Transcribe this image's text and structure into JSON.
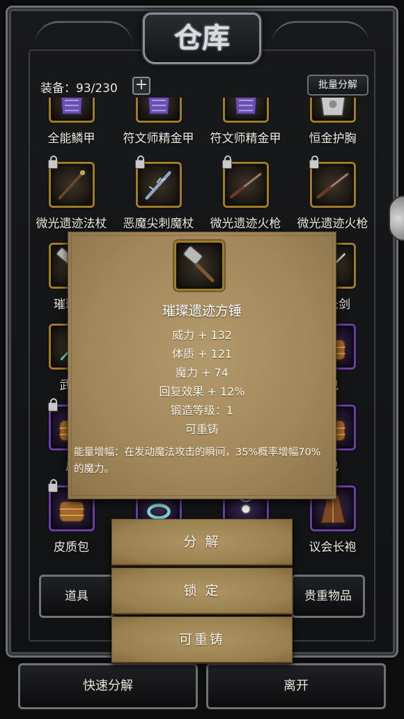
{
  "header": {
    "title": "仓库",
    "equip_label": "装备：93/230",
    "plus_label": "+",
    "bulk_decompose": "批量分解"
  },
  "grid": {
    "items": [
      {
        "name": "全能鳞甲",
        "icon": "purple-armor-icon",
        "locked": false,
        "rarity": "gold"
      },
      {
        "name": "符文师精金甲",
        "icon": "purple-armor-icon",
        "locked": false,
        "rarity": "gold"
      },
      {
        "name": "符文师精金甲",
        "icon": "purple-armor-icon",
        "locked": false,
        "rarity": "gold"
      },
      {
        "name": "恒金护胸",
        "icon": "silver-armor-icon",
        "locked": false,
        "rarity": "gold"
      },
      {
        "name": "微光遗迹法杖",
        "icon": "staff-icon",
        "locked": true,
        "rarity": "gold"
      },
      {
        "name": "恶魔尖刺魔杖",
        "icon": "spiked-wand-icon",
        "locked": true,
        "rarity": "gold"
      },
      {
        "name": "微光遗迹火枪",
        "icon": "musket-icon",
        "locked": true,
        "rarity": "gold"
      },
      {
        "name": "微光遗迹火枪",
        "icon": "musket-icon",
        "locked": true,
        "rarity": "gold"
      },
      {
        "name": "璀璨遗",
        "icon": "hammer-icon",
        "locked": false,
        "rarity": "gold"
      },
      {
        "name": "",
        "icon": "none",
        "locked": false,
        "rarity": "none"
      },
      {
        "name": "",
        "icon": "none",
        "locked": false,
        "rarity": "none"
      },
      {
        "name": "迹长剑",
        "icon": "sword-icon",
        "locked": false,
        "rarity": "gold"
      },
      {
        "name": "武斗",
        "icon": "blade-icon",
        "locked": false,
        "rarity": "gold"
      },
      {
        "name": "",
        "icon": "none",
        "locked": false,
        "rarity": "none"
      },
      {
        "name": "",
        "icon": "none",
        "locked": false,
        "rarity": "none"
      },
      {
        "name": "包",
        "icon": "bag-icon",
        "locked": false,
        "rarity": "purple"
      },
      {
        "name": "皮",
        "icon": "bag-icon",
        "locked": true,
        "rarity": "purple"
      },
      {
        "name": "",
        "icon": "none",
        "locked": false,
        "rarity": "none"
      },
      {
        "name": "",
        "icon": "none",
        "locked": false,
        "rarity": "none"
      },
      {
        "name": "包",
        "icon": "bag-icon",
        "locked": false,
        "rarity": "purple"
      },
      {
        "name": "皮质包",
        "icon": "bag-icon",
        "locked": true,
        "rarity": "purple"
      },
      {
        "name": "",
        "icon": "ring-icon",
        "locked": false,
        "rarity": "purple"
      },
      {
        "name": "",
        "icon": "amulet-icon",
        "locked": false,
        "rarity": "purple"
      },
      {
        "name": "议会长袍",
        "icon": "robe-icon",
        "locked": false,
        "rarity": "purple"
      }
    ]
  },
  "tabs": {
    "items": "道具",
    "valuables": "贵重物品"
  },
  "bottom": {
    "quick_decompose": "快速分解",
    "leave": "离开"
  },
  "popup": {
    "item_name": "璀璨遗迹方锤",
    "icon": "hammer-icon",
    "stats": [
      "威力 + 132",
      "体质 + 121",
      "魔力 + 74",
      "回复效果 + 12%",
      "锻造等级：1",
      "可重铸"
    ],
    "description": "能量增幅：在发动魔法攻击的瞬间，35%概率增幅70%的魔力。"
  },
  "actions": {
    "decompose": "分 解",
    "lock": "锁 定",
    "reforge": "可重铸"
  }
}
